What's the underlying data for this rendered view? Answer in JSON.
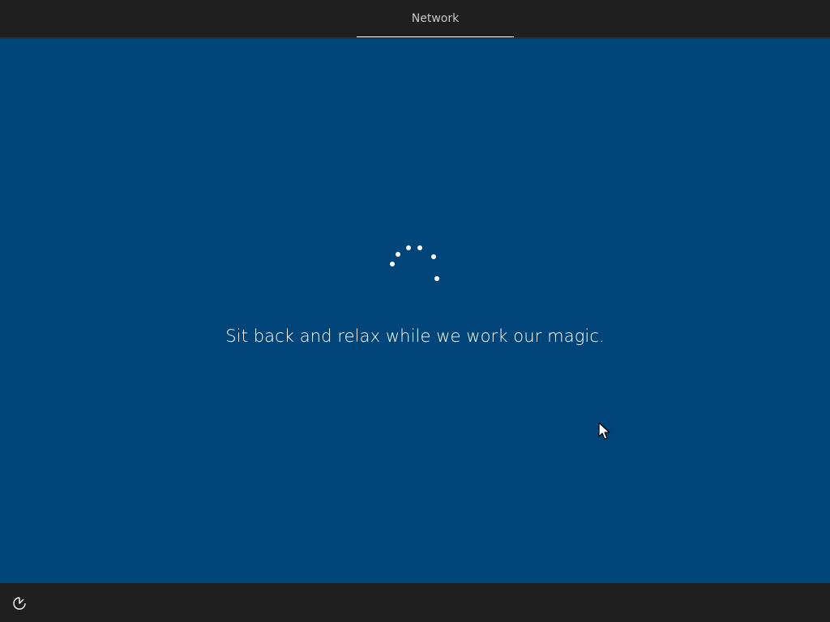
{
  "header": {
    "tab_label": "Network"
  },
  "main": {
    "status_message": "Sit back and relax while we work our magic."
  },
  "icons": {
    "spinner": "loading-spinner-icon",
    "ease_of_access": "ease-of-access-icon",
    "cursor": "mouse-pointer-icon"
  },
  "colors": {
    "background_blue": "#00457a",
    "bar_dark": "#1f1f1f",
    "accent_white": "#ffffff"
  }
}
